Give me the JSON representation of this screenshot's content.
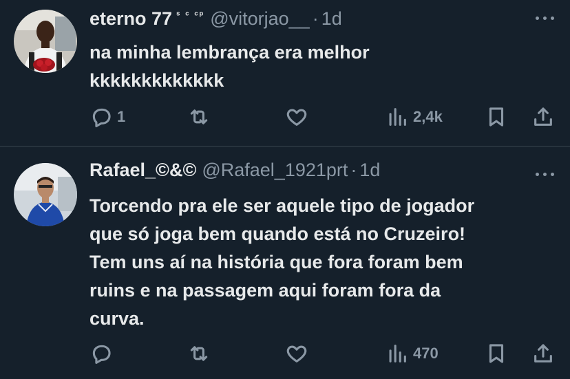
{
  "tweets": [
    {
      "name": "eterno 77",
      "badge": "ˢ ᶜ ᶜᵖ",
      "handle": "@vitorjao__",
      "separator": "·",
      "time": "1d",
      "lines": [
        "na minha lembrança era melhor",
        "kkkkkkkkkkkkk"
      ],
      "replies": "1",
      "retweets": "",
      "likes": "",
      "views": "2,4k"
    },
    {
      "name": "Rafael_©&©",
      "badge": "",
      "handle": "@Rafael_1921prt",
      "separator": "·",
      "time": "1d",
      "lines": [
        "Torcendo pra ele ser aquele tipo de jogador",
        "que só joga bem quando está no Cruzeiro!",
        "Tem uns aí na história que fora foram bem",
        "ruins e na passagem aqui foram fora da",
        "curva."
      ],
      "replies": "",
      "retweets": "",
      "likes": "",
      "views": "470"
    }
  ],
  "icons": {
    "reply": "reply-icon",
    "retweet": "retweet-icon",
    "like": "heart-icon",
    "views": "views-chart-icon",
    "bookmark": "bookmark-icon",
    "share": "share-icon",
    "more": "more-dots-icon"
  },
  "colors": {
    "background": "#15202b",
    "text": "#e7e9ea",
    "secondary": "#8b98a5",
    "divider": "#38444d"
  }
}
